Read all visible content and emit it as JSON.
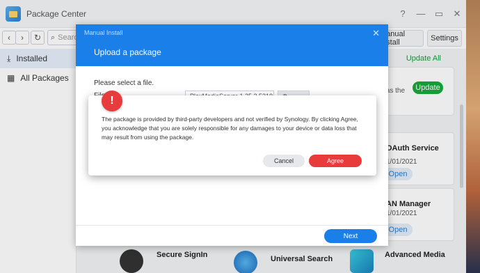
{
  "window": {
    "title": "Package Center"
  },
  "toolbar": {
    "search_placeholder": "Search",
    "manual_install_label": "Manual Install",
    "settings_label": "Settings"
  },
  "sidebar": {
    "items": [
      {
        "label": "Installed",
        "icon": "download-icon"
      },
      {
        "label": "All Packages",
        "icon": "grid-icon"
      }
    ]
  },
  "content": {
    "update_all_label": "Update All",
    "update_card_text": "s as the",
    "update_button_label": "Update",
    "packages": [
      {
        "name": "OAuth Service",
        "date": "1/01/2021",
        "button": "Open"
      },
      {
        "name": "AN Manager",
        "date": "1/01/2021",
        "button": "Open"
      },
      {
        "name": "Secure SignIn"
      },
      {
        "name": "Universal Search"
      },
      {
        "name": "Advanced Media"
      }
    ]
  },
  "dialog": {
    "header_small": "Manual Install",
    "title": "Upload a package",
    "prompt": "Please select a file.",
    "file_label": "File",
    "file_value": "PlexMediaServer-1.25.2.5319",
    "browse_label": "Browse",
    "next_label": "Next"
  },
  "warning": {
    "icon_text": "!",
    "message": "The package is provided by third-party developers and not verified by Synology. By clicking Agree, you acknowledge that you are solely responsible for any damages to your device or data loss that may result from using the package.",
    "cancel_label": "Cancel",
    "agree_label": "Agree"
  },
  "colors": {
    "accent": "#1a7fe8",
    "danger": "#e83b3b",
    "success": "#1aaa3a"
  }
}
